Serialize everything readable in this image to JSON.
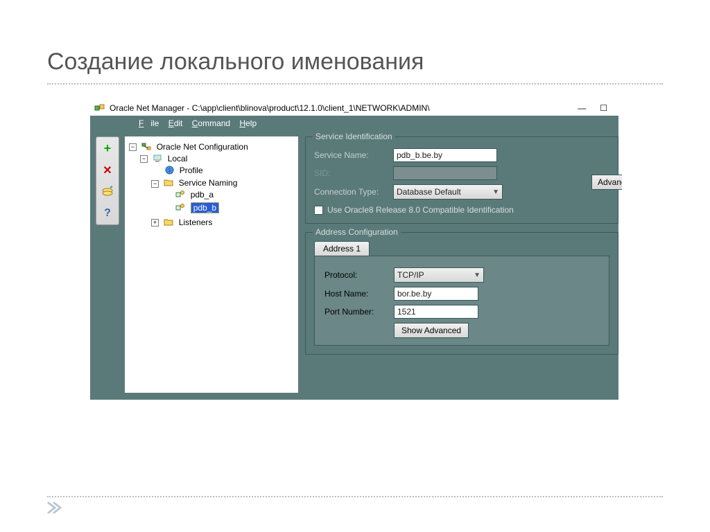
{
  "slide": {
    "title": "Создание локального именования"
  },
  "window": {
    "title": "Oracle Net Manager - C:\\app\\client\\blinova\\product\\12.1.0\\client_1\\NETWORK\\ADMIN\\"
  },
  "menu": {
    "file": "File",
    "edit": "Edit",
    "command": "Command",
    "help": "Help"
  },
  "tree": {
    "root": "Oracle Net Configuration",
    "local": "Local",
    "profile": "Profile",
    "service_naming": "Service Naming",
    "pdb_a": "pdb_a",
    "pdb_b": "pdb_b",
    "listeners": "Listeners"
  },
  "service_id": {
    "legend": "Service Identification",
    "service_name_label": "Service Name:",
    "service_name_value": "pdb_b.be.by",
    "sid_label": "SID:",
    "connection_type_label": "Connection Type:",
    "connection_type_value": "Database Default",
    "advanced_btn": "Advanced",
    "oracle8_label": "Use Oracle8 Release 8.0 Compatible Identification"
  },
  "address": {
    "legend": "Address Configuration",
    "tab1": "Address 1",
    "protocol_label": "Protocol:",
    "protocol_value": "TCP/IP",
    "host_label": "Host Name:",
    "host_value": "bor.be.by",
    "port_label": "Port Number:",
    "port_value": "1521",
    "show_advanced": "Show Advanced"
  }
}
